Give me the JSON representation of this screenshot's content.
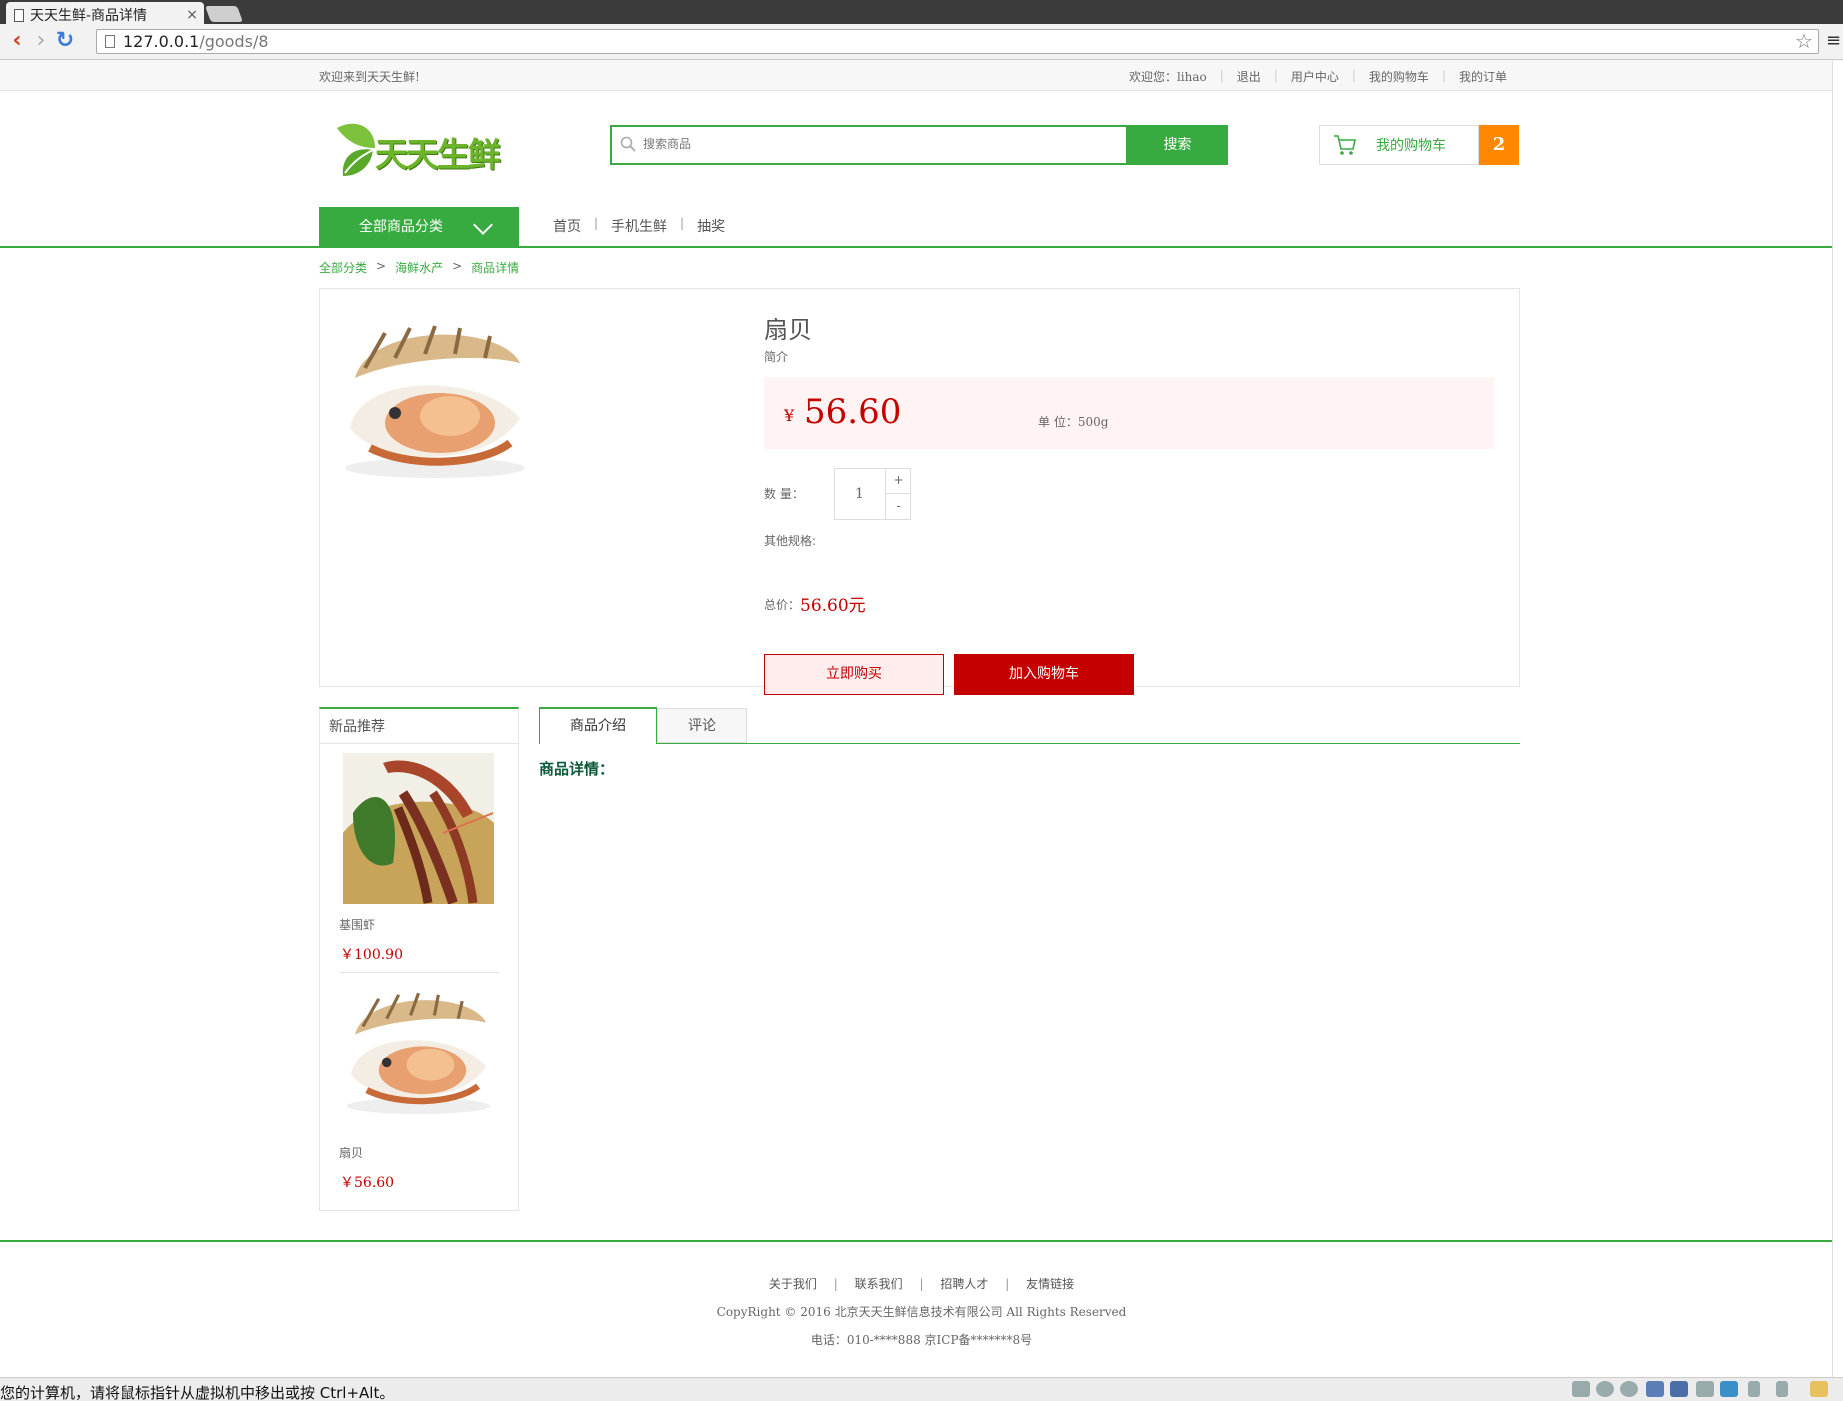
{
  "browser": {
    "tab_title": "天天生鲜-商品详情",
    "tab_close": "×",
    "url_host": "127.0.0.1",
    "url_path": "/goods/8",
    "back": "‹",
    "forward": "›",
    "reload": "↻",
    "star": "☆",
    "menu": "≡"
  },
  "topbar": {
    "welcome": "欢迎来到天天生鲜!",
    "user_greeting": "欢迎您：lihao",
    "logout": "退出",
    "user_center": "用户中心",
    "my_cart": "我的购物车",
    "my_orders": "我的订单",
    "sep": "|"
  },
  "header": {
    "logo_text": "天天生鲜",
    "search_placeholder": "搜索商品",
    "search_button": "搜索",
    "cart_label": "我的购物车",
    "cart_count": "2"
  },
  "nav": {
    "all_categories": "全部商品分类",
    "items": [
      "首页",
      "手机生鲜",
      "抽奖"
    ],
    "sep": "|"
  },
  "breadcrumb": {
    "items": [
      "全部分类",
      "海鲜水产",
      "商品详情"
    ],
    "sep": ">"
  },
  "product": {
    "name": "扇贝",
    "desc": "简介",
    "price_symbol": "¥",
    "price": "56.60",
    "unit": "单 位：500g",
    "qty_label": "数 量：",
    "qty": "1",
    "plus": "+",
    "minus": "-",
    "other_spec": "其他规格:",
    "total_label": "总价：",
    "total_value": "56.60元",
    "buy_now": "立即购买",
    "add_cart": "加入购物车"
  },
  "new_products": {
    "title": "新品推荐",
    "items": [
      {
        "name": "基围虾",
        "price": "￥100.90"
      },
      {
        "name": "扇贝",
        "price": "￥56.60"
      }
    ]
  },
  "tabs": {
    "intro": "商品介绍",
    "comment": "评论",
    "detail_title": "商品详情："
  },
  "footer": {
    "links": [
      "关于我们",
      "联系我们",
      "招聘人才",
      "友情链接"
    ],
    "sep": "|",
    "copyright": "CopyRight © 2016 北京天天生鲜信息技术有限公司 All Rights Reserved",
    "contact": "电话：010-****888 京ICP备*******8号"
  },
  "vm_status": {
    "text": "您的计算机，请将鼠标指针从虚拟机中移出或按 Ctrl+Alt。"
  },
  "colors": {
    "green": "#37ab40",
    "price_red": "#c40000",
    "cart_orange": "#ff8800"
  }
}
